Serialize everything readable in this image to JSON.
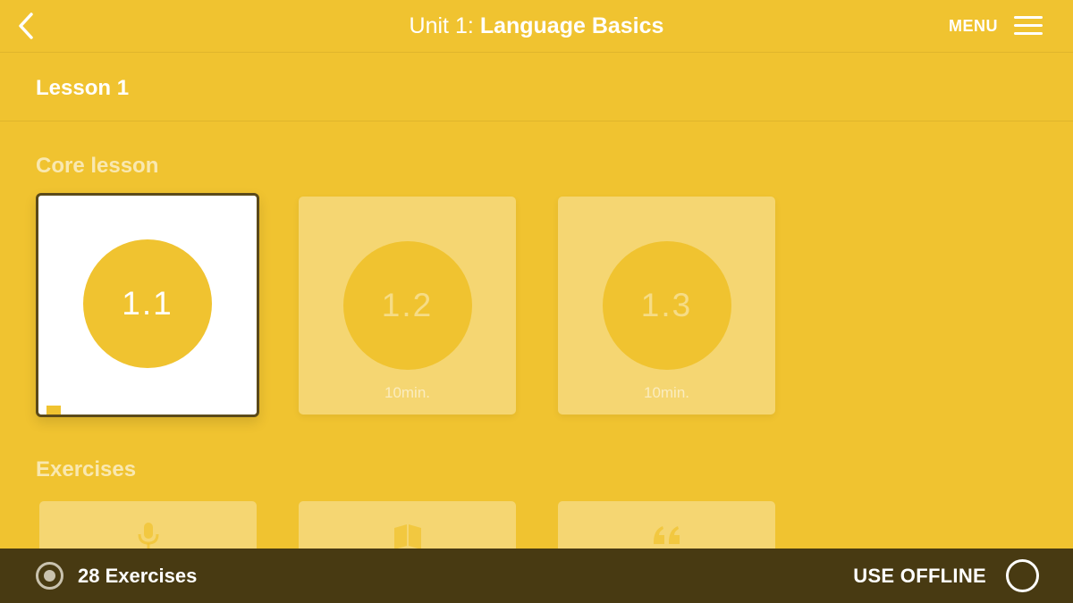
{
  "header": {
    "back_icon": "chevron-left-icon",
    "title_prefix": "Unit 1:",
    "title_name": "Language Basics",
    "menu_label": "MENU",
    "menu_icon": "hamburger-icon"
  },
  "lesson": {
    "title": "Lesson 1"
  },
  "core": {
    "heading": "Core lesson",
    "cards": [
      {
        "number": "1.1",
        "duration": "",
        "state": "active"
      },
      {
        "number": "1.2",
        "duration": "10min.",
        "state": "locked"
      },
      {
        "number": "1.3",
        "duration": "10min.",
        "state": "locked"
      }
    ]
  },
  "exercises": {
    "heading": "Exercises",
    "cards": [
      {
        "icon": "microphone-icon"
      },
      {
        "icon": "book-icon"
      },
      {
        "icon": "quote-icon"
      }
    ]
  },
  "footer": {
    "count_icon": "radio-target-icon",
    "count_label": "28 Exercises",
    "offline_label": "USE OFFLINE",
    "offline_toggle_icon": "empty-circle-icon"
  },
  "colors": {
    "background": "#F0C330",
    "footer": "#483A12",
    "active_border": "#5B4A1A"
  }
}
